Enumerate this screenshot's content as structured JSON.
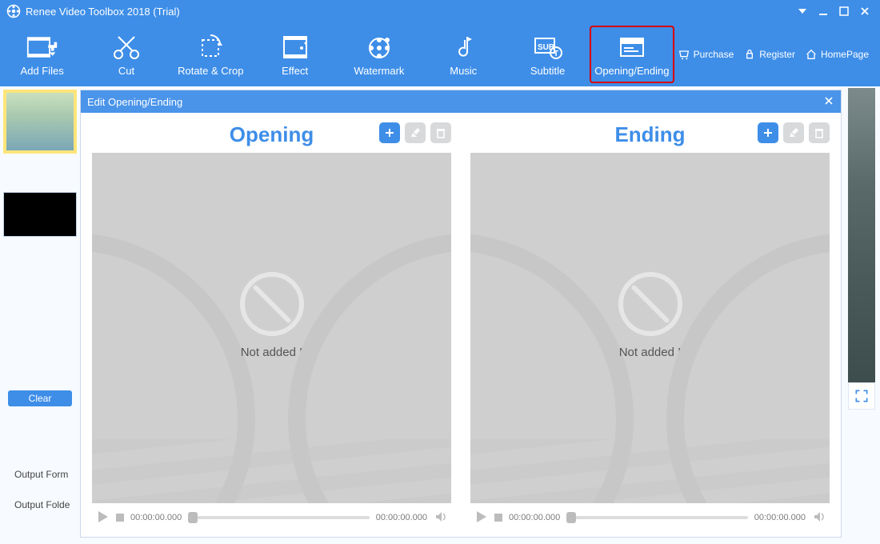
{
  "app": {
    "title": "Renee Video Toolbox 2018 (Trial)"
  },
  "toolbar": {
    "items": [
      {
        "label": "Add Files"
      },
      {
        "label": "Cut"
      },
      {
        "label": "Rotate & Crop"
      },
      {
        "label": "Effect"
      },
      {
        "label": "Watermark"
      },
      {
        "label": "Music"
      },
      {
        "label": "Subtitle"
      },
      {
        "label": "Opening/Ending",
        "selected": true
      }
    ],
    "links": {
      "purchase": "Purchase",
      "register": "Register",
      "homepage": "HomePage"
    }
  },
  "sidebar": {
    "clear": "Clear",
    "output_format_label": "Output Form",
    "output_folder_label": "Output Folde"
  },
  "dialog": {
    "title": "Edit Opening/Ending",
    "opening": {
      "title": "Opening",
      "empty_text": "Not added !",
      "time_start": "00:00:00.000",
      "time_end": "00:00:00.000"
    },
    "ending": {
      "title": "Ending",
      "empty_text": "Not added !",
      "time_start": "00:00:00.000",
      "time_end": "00:00:00.000"
    }
  }
}
